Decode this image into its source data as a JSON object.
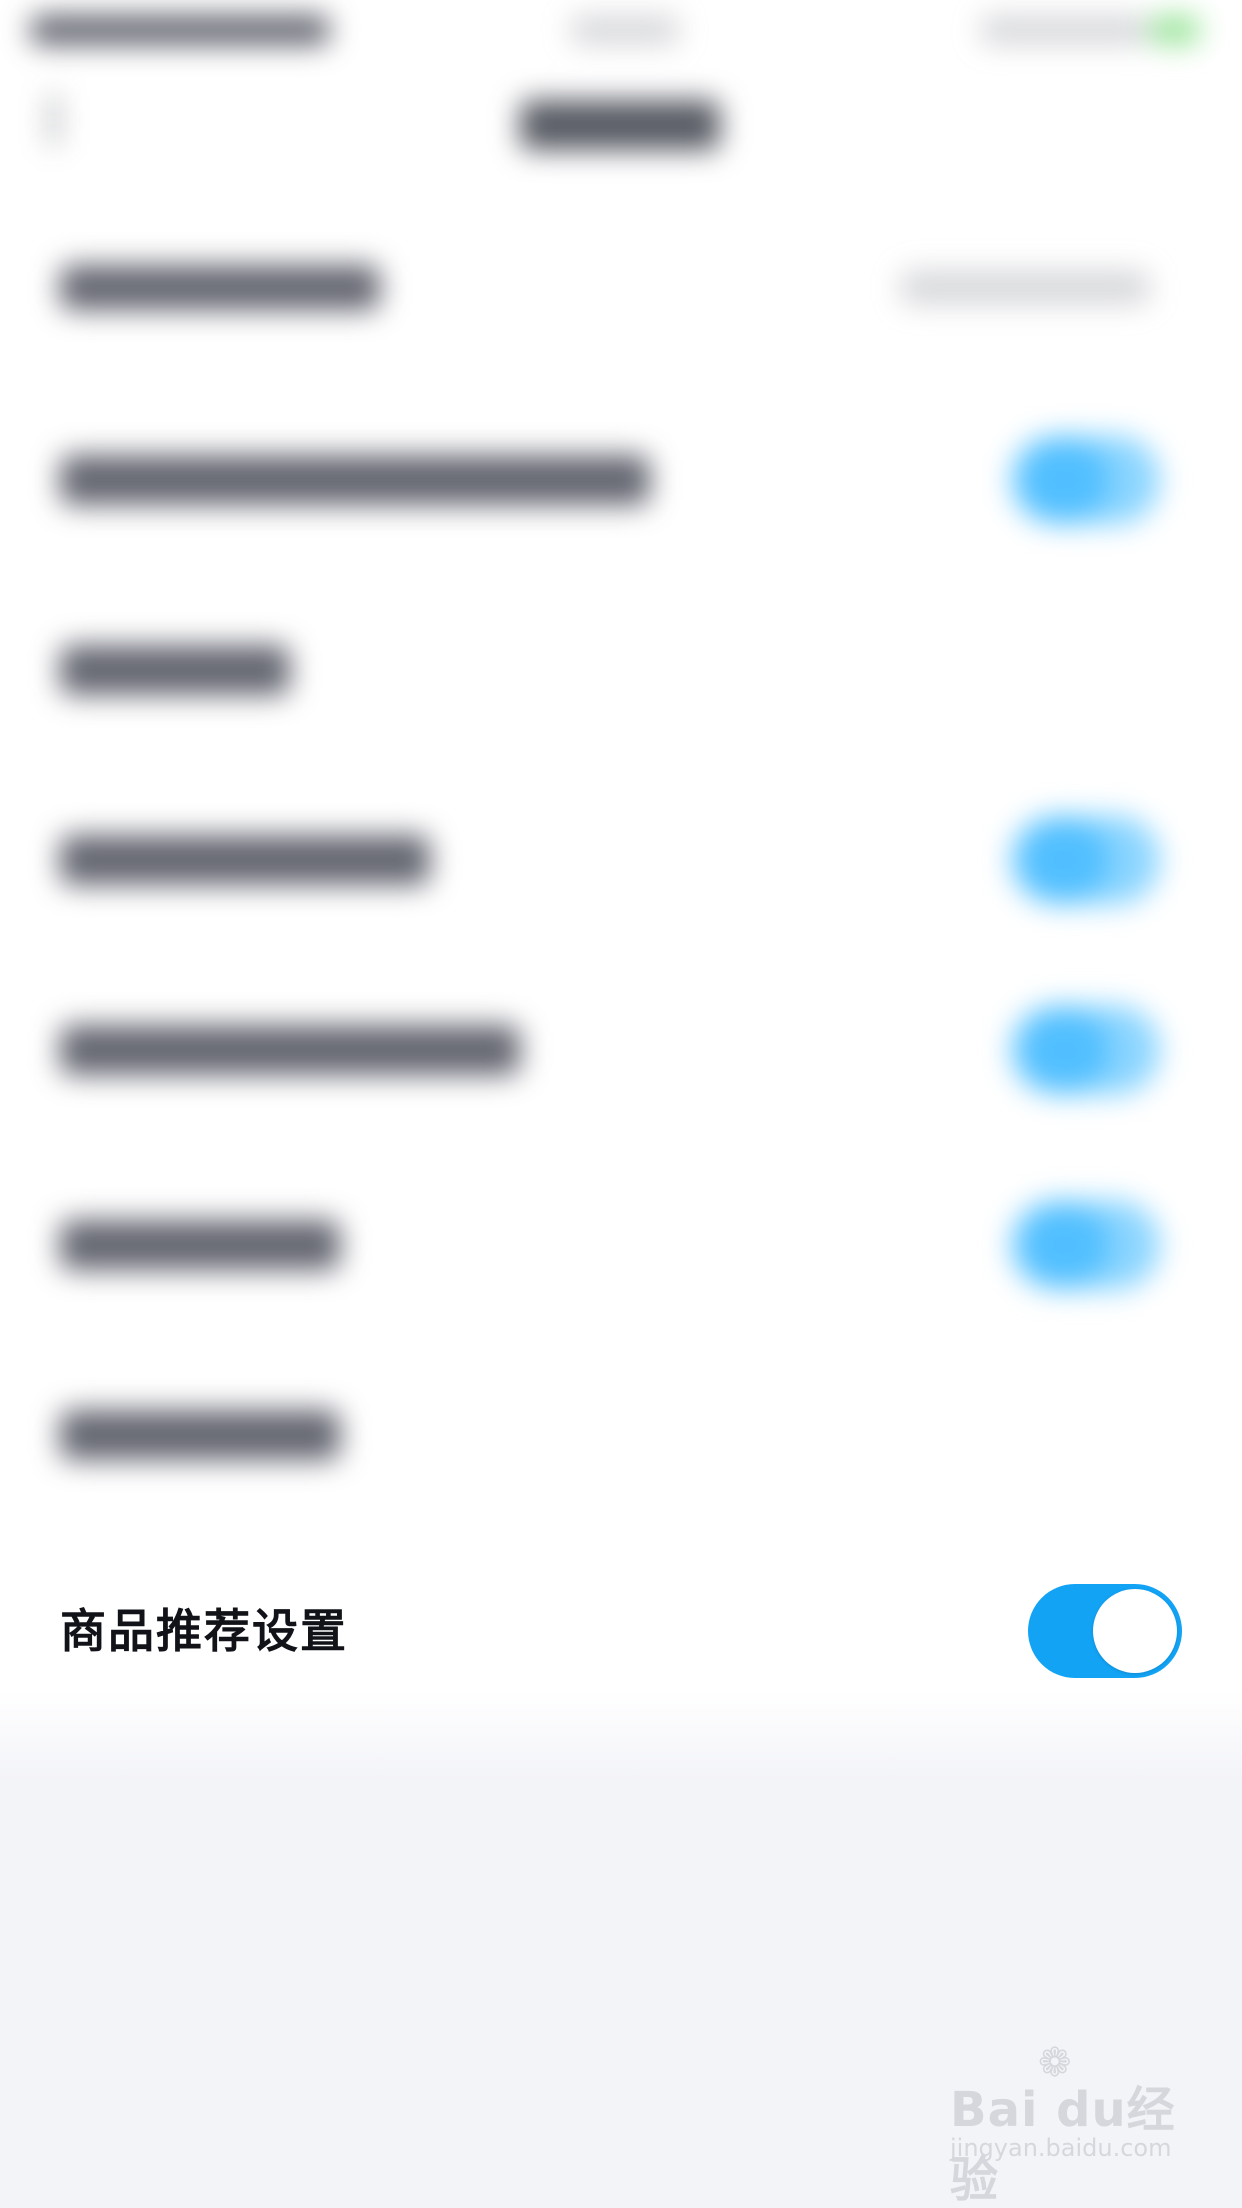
{
  "settings": {
    "visible_row": {
      "label": "商品推荐设置",
      "toggle_on": true
    }
  },
  "colors": {
    "toggle_on": "#12a3f5",
    "label_text": "#111318",
    "page_bg": "#f3f4f8",
    "panel_bg": "#ffffff"
  },
  "watermark": {
    "logo": "Bai du",
    "logo_suffix": "经验",
    "url": "jingyan.baidu.com"
  }
}
